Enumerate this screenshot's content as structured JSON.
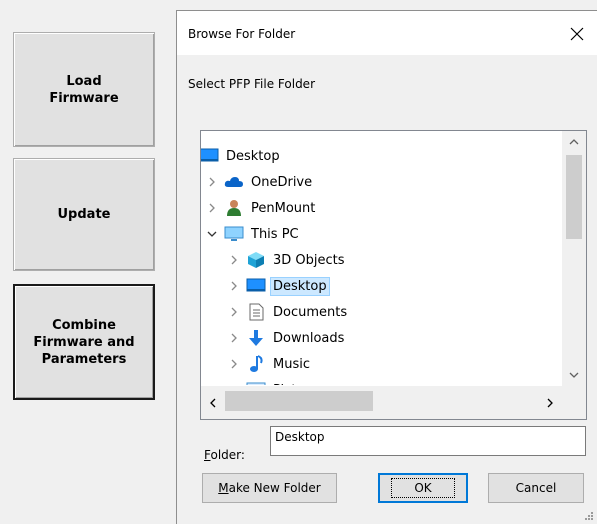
{
  "app": {
    "buttons": [
      {
        "label": "Load\nFirmware"
      },
      {
        "label": "Update"
      },
      {
        "label": "Combine\nFirmware and\nParameters"
      }
    ]
  },
  "dialog": {
    "title": "Browse For Folder",
    "instruction": "Select PFP File Folder",
    "tree": [
      {
        "label": "Desktop",
        "icon": "desktop-icon",
        "level": 0,
        "expander": "none"
      },
      {
        "label": "OneDrive",
        "icon": "cloud-icon",
        "level": 1,
        "expander": "collapsed"
      },
      {
        "label": "PenMount",
        "icon": "user-icon",
        "level": 1,
        "expander": "collapsed"
      },
      {
        "label": "This PC",
        "icon": "computer-icon",
        "level": 1,
        "expander": "expanded"
      },
      {
        "label": "3D Objects",
        "icon": "cube-icon",
        "level": 2,
        "expander": "collapsed"
      },
      {
        "label": "Desktop",
        "icon": "desktop-icon",
        "level": 2,
        "expander": "collapsed",
        "selected": true
      },
      {
        "label": "Documents",
        "icon": "document-icon",
        "level": 2,
        "expander": "collapsed"
      },
      {
        "label": "Downloads",
        "icon": "download-icon",
        "level": 2,
        "expander": "collapsed"
      },
      {
        "label": "Music",
        "icon": "music-icon",
        "level": 2,
        "expander": "collapsed"
      },
      {
        "label": "Pictures",
        "icon": "pictures-icon",
        "level": 2,
        "expander": "collapsed"
      }
    ],
    "folder_label_accel": "F",
    "folder_label_rest": "older:",
    "folder_value": "Desktop",
    "new_folder_accel": "M",
    "new_folder_rest": "ake New Folder",
    "ok_label": "OK",
    "cancel_label": "Cancel"
  },
  "colors": {
    "selection": "#cce8ff",
    "default_button_border": "#0078d7"
  }
}
